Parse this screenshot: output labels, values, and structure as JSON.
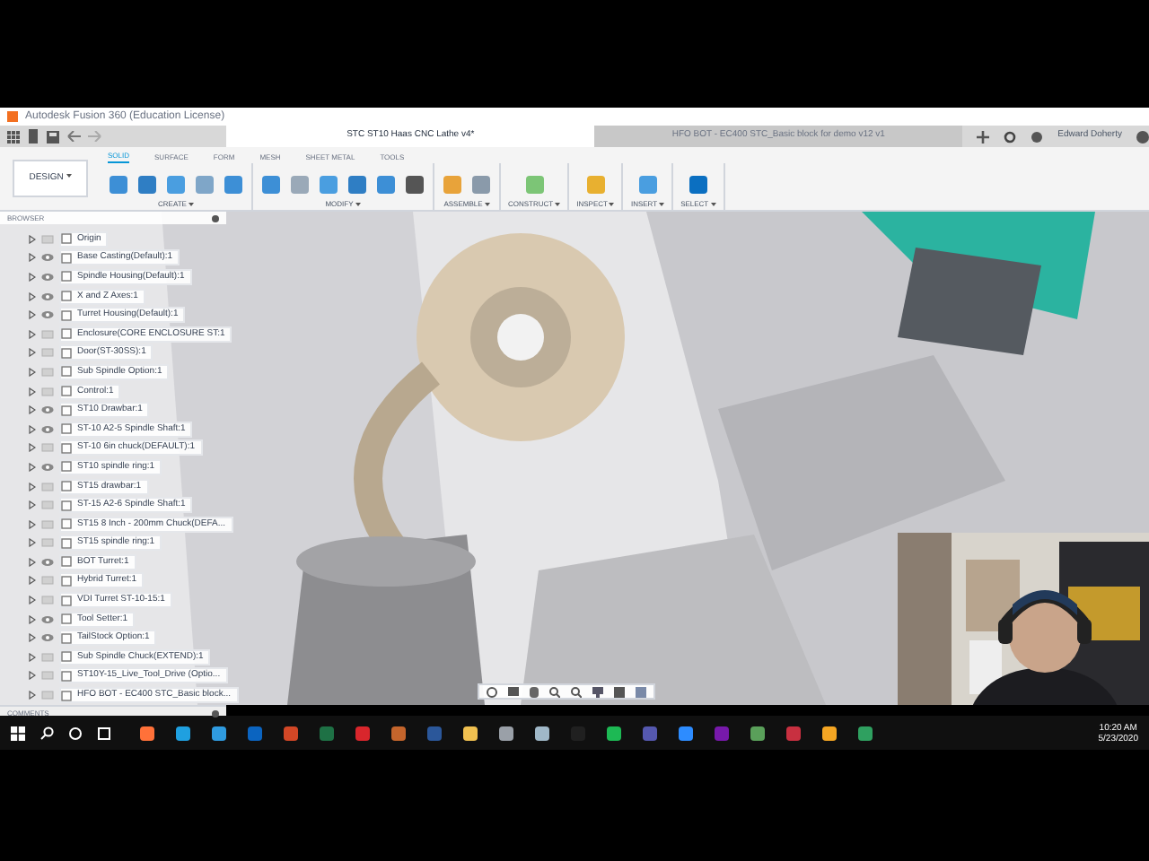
{
  "window": {
    "title": "Autodesk Fusion 360 (Education License)"
  },
  "document_tabs": [
    {
      "label": "STC ST10 Haas CNC Lathe v4*",
      "selected": true
    },
    {
      "label": "HFO BOT - EC400 STC_Basic block for demo v12 v1",
      "selected": false
    }
  ],
  "user": "Edward Doherty",
  "workspace": "DESIGN",
  "toolbar_tabs": [
    {
      "label": "SOLID",
      "selected": true
    },
    {
      "label": "SURFACE",
      "selected": false
    },
    {
      "label": "FORM",
      "selected": false
    },
    {
      "label": "MESH",
      "selected": false
    },
    {
      "label": "SHEET METAL",
      "selected": false
    },
    {
      "label": "TOOLS",
      "selected": false
    }
  ],
  "tool_groups": [
    {
      "label": "CREATE"
    },
    {
      "label": "MODIFY"
    },
    {
      "label": "ASSEMBLE"
    },
    {
      "label": "CONSTRUCT"
    },
    {
      "label": "INSPECT"
    },
    {
      "label": "INSERT"
    },
    {
      "label": "SELECT"
    }
  ],
  "browser": {
    "title": "BROWSER",
    "items": [
      {
        "label": "Origin",
        "visible": false
      },
      {
        "label": "Base Casting(Default):1",
        "visible": true
      },
      {
        "label": "Spindle Housing(Default):1",
        "visible": true
      },
      {
        "label": "X and Z Axes:1",
        "visible": true
      },
      {
        "label": "Turret Housing(Default):1",
        "visible": true
      },
      {
        "label": "Enclosure(CORE ENCLOSURE ST:1",
        "visible": false
      },
      {
        "label": "Door(ST-30SS):1",
        "visible": false
      },
      {
        "label": "Sub Spindle Option:1",
        "visible": false
      },
      {
        "label": "Control:1",
        "visible": false
      },
      {
        "label": "ST10 Drawbar:1",
        "visible": true
      },
      {
        "label": "ST-10 A2-5 Spindle Shaft:1",
        "visible": true
      },
      {
        "label": "ST-10 6in chuck(DEFAULT):1",
        "visible": false
      },
      {
        "label": "ST10 spindle ring:1",
        "visible": true
      },
      {
        "label": "ST15 drawbar:1",
        "visible": false
      },
      {
        "label": "ST-15 A2-6 Spindle Shaft:1",
        "visible": false
      },
      {
        "label": "ST15 8 Inch - 200mm Chuck(DEFA...",
        "visible": false
      },
      {
        "label": "ST15 spindle ring:1",
        "visible": false
      },
      {
        "label": "BOT Turret:1",
        "visible": true
      },
      {
        "label": "Hybrid Turret:1",
        "visible": false
      },
      {
        "label": "VDI Turret ST-10-15:1",
        "visible": false
      },
      {
        "label": "Tool Setter:1",
        "visible": true
      },
      {
        "label": "TailStock Option:1",
        "visible": true
      },
      {
        "label": "Sub Spindle Chuck(EXTEND):1",
        "visible": false
      },
      {
        "label": "ST10Y-15_Live_Tool_Drive (Optio...",
        "visible": false
      },
      {
        "label": "HFO BOT - EC400 STC_Basic block...",
        "visible": false
      }
    ]
  },
  "comments": {
    "title": "COMMENTS"
  },
  "clock": {
    "time": "10:20 AM",
    "date": "5/23/2020"
  }
}
